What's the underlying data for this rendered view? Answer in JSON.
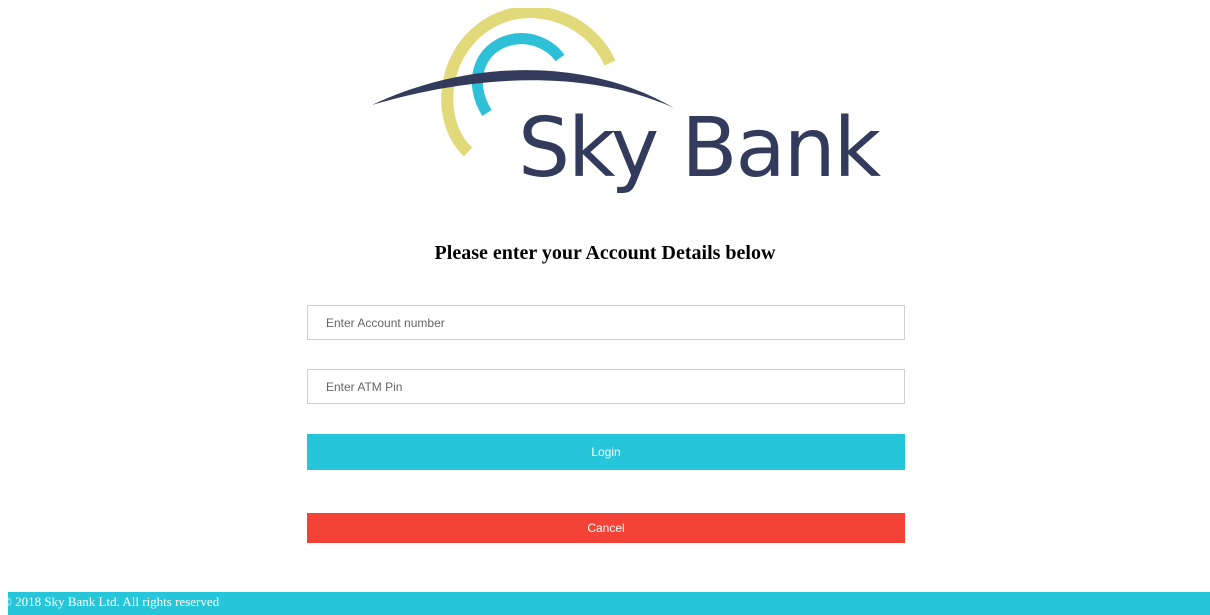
{
  "brand": {
    "name": "Sky Bank",
    "colors": {
      "navy": "#323b5c",
      "yellow": "#e2d97a",
      "cyan": "#2ec0d6"
    }
  },
  "form": {
    "heading": "Please enter your Account Details below",
    "account_number": {
      "placeholder": "Enter Account number",
      "value": ""
    },
    "atm_pin": {
      "placeholder": "Enter ATM Pin",
      "value": ""
    },
    "login_label": "Login",
    "cancel_label": "Cancel"
  },
  "footer": {
    "copyright": "© 2018 Sky Bank Ltd. All rights reserved"
  },
  "colors": {
    "accent": "#26c6da",
    "danger": "#f44336"
  }
}
